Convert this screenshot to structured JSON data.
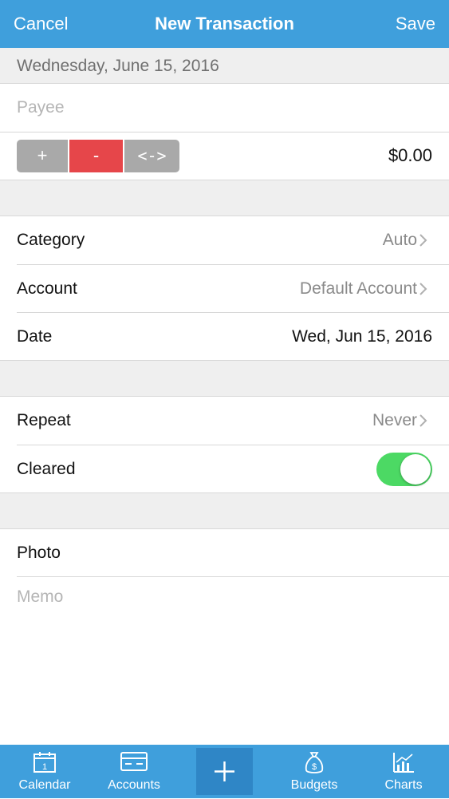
{
  "nav": {
    "cancel": "Cancel",
    "title": "New Transaction",
    "save": "Save"
  },
  "date_header": "Wednesday, June 15, 2016",
  "payee": {
    "placeholder": "Payee"
  },
  "type_segment": {
    "plus": "+",
    "minus": "-",
    "swap": "<->",
    "selected": "minus"
  },
  "amount": "$0.00",
  "category": {
    "label": "Category",
    "value": "Auto"
  },
  "account": {
    "label": "Account",
    "value": "Default Account"
  },
  "date": {
    "label": "Date",
    "value": "Wed, Jun 15, 2016"
  },
  "repeat": {
    "label": "Repeat",
    "value": "Never"
  },
  "cleared": {
    "label": "Cleared",
    "on": true
  },
  "photo": {
    "label": "Photo"
  },
  "memo": {
    "placeholder": "Memo"
  },
  "tabs": [
    {
      "label": "Calendar",
      "icon": "calendar-icon"
    },
    {
      "label": "Accounts",
      "icon": "card-icon"
    },
    {
      "label": "",
      "icon": "plus-icon"
    },
    {
      "label": "Budgets",
      "icon": "money-bag-icon"
    },
    {
      "label": "Charts",
      "icon": "chart-icon"
    }
  ],
  "colors": {
    "accent": "#3f9fdc",
    "minus": "#e6464a",
    "toggle_on": "#4cd964"
  }
}
